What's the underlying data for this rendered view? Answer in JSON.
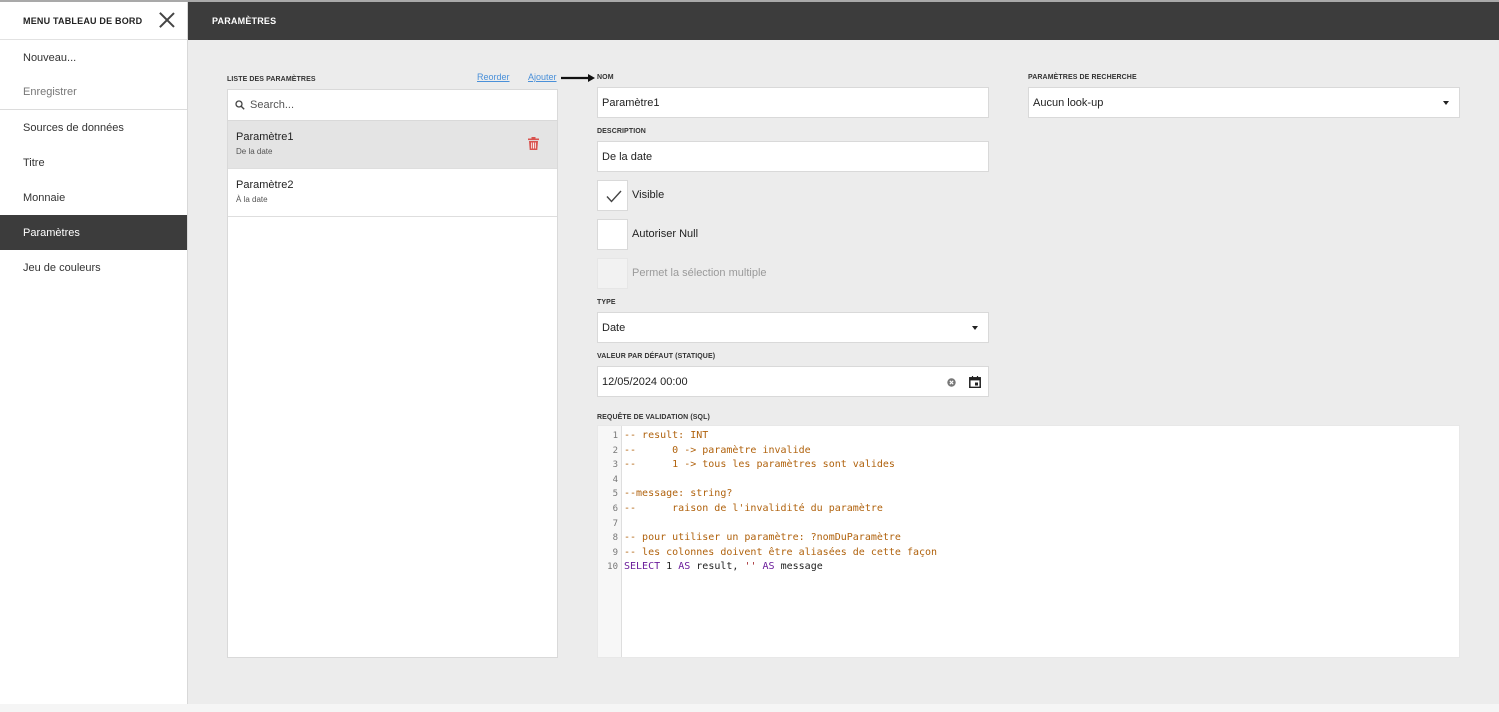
{
  "sidebar": {
    "title": "MENU TABLEAU DE BORD",
    "items": [
      {
        "label": "Nouveau..."
      },
      {
        "label": "Enregistrer"
      },
      {
        "label": "Sources de données"
      },
      {
        "label": "Titre"
      },
      {
        "label": "Monnaie"
      },
      {
        "label": "Paramètres"
      },
      {
        "label": "Jeu de couleurs"
      }
    ]
  },
  "header": {
    "title": "PARAMÈTRES"
  },
  "params_list": {
    "label": "LISTE DES PARAMÈTRES",
    "reorder_label": "Reorder",
    "add_label": "Ajouter",
    "search_placeholder": "Search...",
    "items": [
      {
        "name": "Paramètre1",
        "description": "De la date",
        "selected": true
      },
      {
        "name": "Paramètre2",
        "description": "À la date",
        "selected": false
      }
    ]
  },
  "form": {
    "name_label": "NOM",
    "name_value": "Paramètre1",
    "description_label": "DESCRIPTION",
    "description_value": "De la date",
    "visible_label": "Visible",
    "visible_checked": true,
    "allow_null_label": "Autoriser Null",
    "allow_null_checked": false,
    "multi_select_label": "Permet la sélection multiple",
    "multi_select_enabled": false,
    "type_label": "TYPE",
    "type_value": "Date",
    "default_label": "VALEUR PAR DÉFAUT (STATIQUE)",
    "default_value": "12/05/2024 00:00",
    "lookup_label": "PARAMÈTRES DE RECHERCHE",
    "lookup_value": "Aucun look-up",
    "sql_label": "REQUÊTE DE VALIDATION (SQL)"
  },
  "sql_lines": [
    {
      "n": "1",
      "text": "-- result: INT"
    },
    {
      "n": "2",
      "text": "--      0 -> paramètre invalide"
    },
    {
      "n": "3",
      "text": "--      1 -> tous les paramètres sont valides"
    },
    {
      "n": "4",
      "text": ""
    },
    {
      "n": "5",
      "text": "--message: string?"
    },
    {
      "n": "6",
      "text": "--      raison de l'invalidité du paramètre"
    },
    {
      "n": "7",
      "text": ""
    },
    {
      "n": "8",
      "text": "-- pour utiliser un paramètre: ?nomDuParamètre"
    },
    {
      "n": "9",
      "text": "-- les colonnes doivent être aliasées de cette façon"
    },
    {
      "n": "10",
      "text": "SELECT 1 AS result, '' AS message"
    }
  ],
  "colors": {
    "dark_bar": "#3c3c3c",
    "link": "#4a90d9",
    "delete": "#d9534f",
    "sql_comment": "#b0620d",
    "sql_keyword": "#6a1b9a"
  },
  "icons": {
    "close": "close-icon",
    "search": "search-icon",
    "delete": "trash-icon",
    "check": "check-icon",
    "clear": "clear-icon",
    "calendar": "calendar-icon",
    "arrow": "arrow-icon",
    "dropdown": "chevron-down-icon"
  }
}
